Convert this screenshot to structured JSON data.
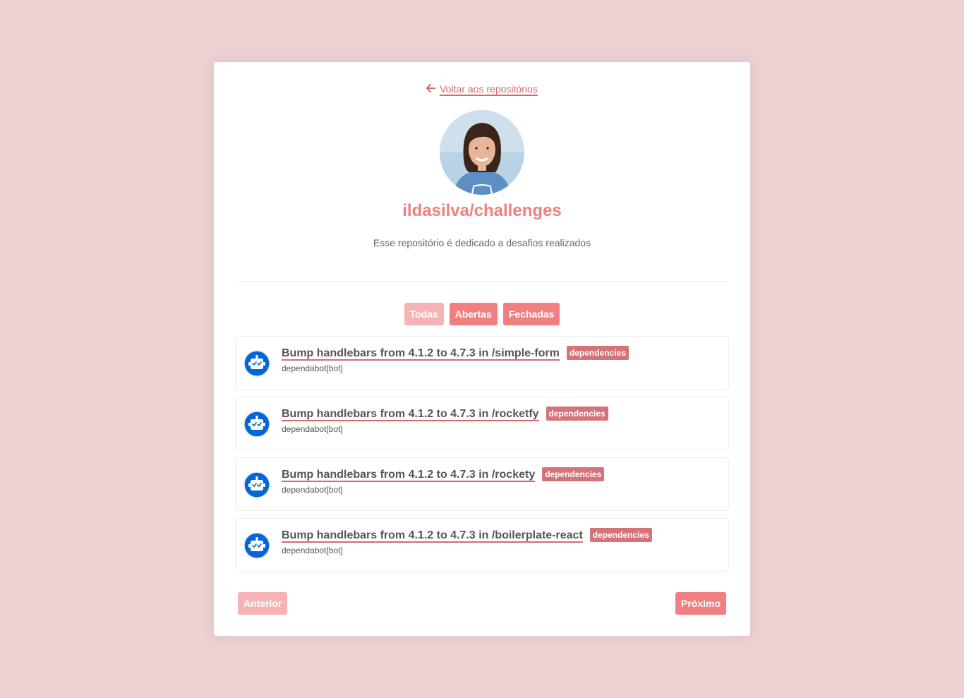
{
  "back_link": {
    "label": "Voltar aos repositórios",
    "icon": "arrow-left-icon"
  },
  "repository": {
    "name": "ildasilva/challenges",
    "description": "Esse repositório é dedicado a desafios realizados"
  },
  "filters": [
    {
      "label": "Todas",
      "state": "disabled"
    },
    {
      "label": "Abertas",
      "state": "enabled"
    },
    {
      "label": "Fechadas",
      "state": "enabled"
    }
  ],
  "issues": [
    {
      "title": "Bump handlebars from 4.1.2 to 4.7.3 in /simple-form",
      "label": "dependencies",
      "author": "dependabot[bot]"
    },
    {
      "title": "Bump handlebars from 4.1.2 to 4.7.3 in /rocketfy",
      "label": "dependencies",
      "author": "dependabot[bot]"
    },
    {
      "title": "Bump handlebars from 4.1.2 to 4.7.3 in /rockety",
      "label": "dependencies",
      "author": "dependabot[bot]"
    },
    {
      "title": "Bump handlebars from 4.1.2 to 4.7.3 in /boilerplate-react",
      "label": "dependencies",
      "author": "dependabot[bot]"
    }
  ],
  "pagination": {
    "prev_label": "Anterior",
    "prev_state": "disabled",
    "next_label": "Próximo",
    "next_state": "enabled"
  },
  "colors": {
    "page_background": "#edd0d2",
    "accent": "#f07f82",
    "accent_disabled": "#f6b3b5",
    "label_background": "#d5737a",
    "title": "#f08080",
    "bot_blue": "#0366d6"
  }
}
